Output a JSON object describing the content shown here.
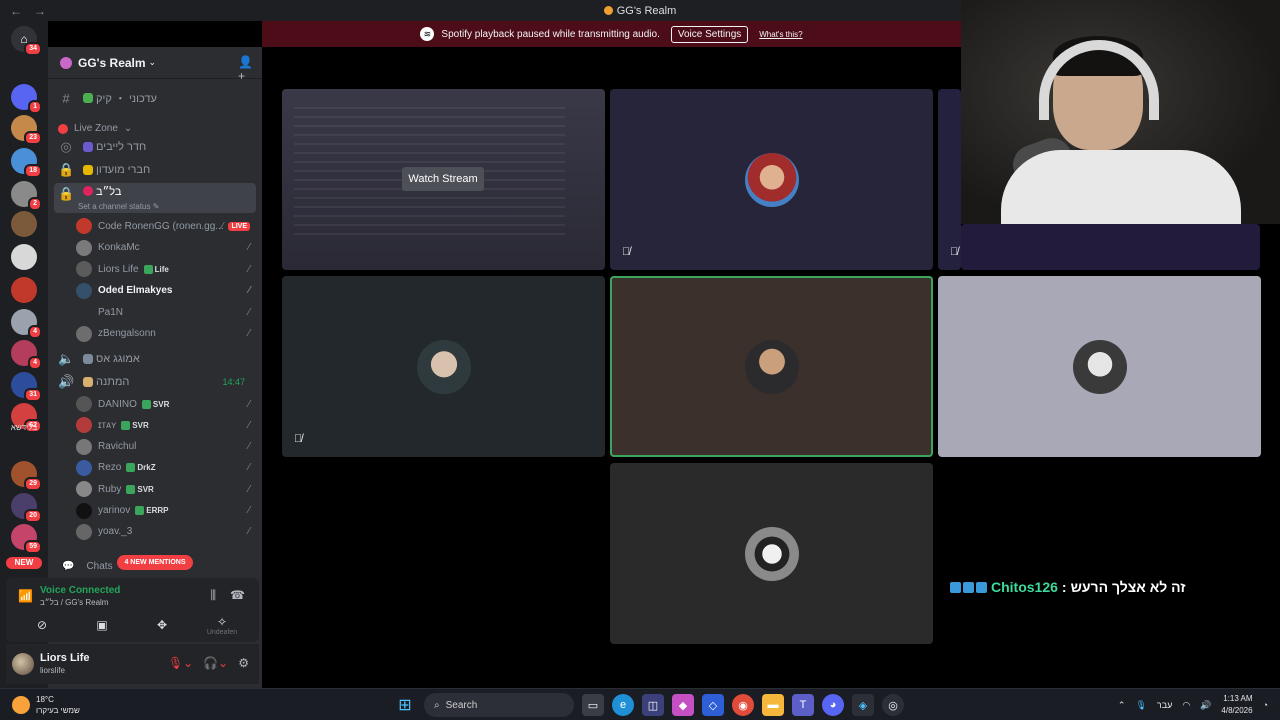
{
  "window": {
    "title": "GG's Realm",
    "back": "←",
    "forward": "→"
  },
  "rail": {
    "dm_badge": "34",
    "servers": [
      {
        "color": "#5865f2",
        "badge": "1"
      },
      {
        "color": "#c58a4a",
        "badge": "23"
      },
      {
        "color": "#4a90d9",
        "badge": "18"
      },
      {
        "color": "#8a8a8a",
        "badge": "2"
      },
      {
        "color": "#7a5a3a",
        "badge": ""
      },
      {
        "color": "#d8d8d8",
        "badge": ""
      },
      {
        "color": "#c0392b",
        "badge": ""
      },
      {
        "color": "#9aa3ad",
        "badge": "4"
      },
      {
        "color": "#b43d5c",
        "badge": "4"
      },
      {
        "color": "#2c4c9c",
        "badge": "31"
      },
      {
        "color": "#d43f3f",
        "badge": "62"
      }
    ],
    "folder_label": "בלידשא",
    "servers2": [
      {
        "color": "#a0522d",
        "badge": "29"
      },
      {
        "color": "#4a3f6b",
        "badge": "20"
      },
      {
        "color": "#c44569",
        "badge": "59"
      }
    ],
    "new_label": "NEW"
  },
  "server": {
    "name": "GG's Realm"
  },
  "channels": {
    "updates": "עדכוני ・ קיק",
    "live_zone": "Live Zone",
    "live_room": "חדר לייבים",
    "members_club": "חברי מועדון",
    "baliv": "בל״ב",
    "set_status": "Set a channel status",
    "amog": "אמוגג אס",
    "waiting": "המתנה",
    "waiting_time": "14:47",
    "chats": "Chats"
  },
  "voice_users_1": [
    {
      "name": "Code RonenGG (ronen.gg...",
      "color": "#c0392b",
      "tag": "",
      "live": "LIVE"
    },
    {
      "name": "KonkaMc",
      "color": "#7a7a7a",
      "tag": ""
    },
    {
      "name": "Liors Life",
      "color": "#5b5b5b",
      "tag": "Life"
    },
    {
      "name": "Oded Elmakyes",
      "color": "#35506a",
      "tag": ""
    },
    {
      "name": "Pa1N",
      "color": "#2b2d31",
      "tag": ""
    },
    {
      "name": "zBengalsonn",
      "color": "#6d6d6d",
      "tag": ""
    }
  ],
  "voice_users_2": [
    {
      "name": "DANINO",
      "color": "#555",
      "tag": "SVR"
    },
    {
      "name": "ɪᴛᴀʏ",
      "color": "#b33b3b",
      "tag": "SVR"
    },
    {
      "name": "Ravichul",
      "color": "#777",
      "tag": ""
    },
    {
      "name": "Rezo",
      "color": "#3b5ba0",
      "tag": "DrkZ"
    },
    {
      "name": "Ruby",
      "color": "#888",
      "tag": "SVR"
    },
    {
      "name": "yarinov",
      "color": "#111",
      "tag": "ERRP"
    },
    {
      "name": "yoav._3",
      "color": "#666",
      "tag": ""
    }
  ],
  "mentions": "4 NEW MENTIONS",
  "voice": {
    "status": "Voice Connected",
    "channel": "בל״ב / GG's Realm",
    "undeafen": "Undeafen"
  },
  "me": {
    "display": "Liors Life",
    "username": "liorslife"
  },
  "banner": {
    "text": "Spotify playback paused while transmitting audio.",
    "button": "Voice Settings",
    "link": "What's this?"
  },
  "call": {
    "watch": "Watch Stream"
  },
  "overlay_chat": {
    "nick": "Chitos126",
    "sep": ":",
    "message": "זה לא אצלך הרעש"
  },
  "taskbar": {
    "temp": "18°C",
    "weather": "שמשי בעיקרו",
    "search": "Search",
    "lang": "עבר",
    "time": "1:13 AM",
    "date": "4/8/2026"
  }
}
